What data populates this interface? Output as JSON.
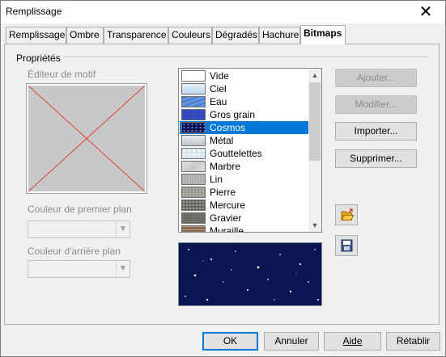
{
  "window": {
    "title": "Remplissage",
    "close_glyph": "✕"
  },
  "tabs": [
    {
      "label": "Remplissage"
    },
    {
      "label": "Ombre"
    },
    {
      "label": "Transparence"
    },
    {
      "label": "Couleurs"
    },
    {
      "label": "Dégradés"
    },
    {
      "label": "Hachure"
    },
    {
      "label": "Bitmaps",
      "active": true
    }
  ],
  "properties": {
    "section_label": "Propriétés",
    "pattern_editor_label": "Éditeur de motif",
    "foreground_color_label": "Couleur de premier plan",
    "foreground_color_value": "",
    "background_color_label": "Couleur d'arrière plan",
    "background_color_value": ""
  },
  "bitmaps": {
    "selected": "Cosmos",
    "items": [
      {
        "label": "Vide",
        "swatch": "#ffffff"
      },
      {
        "label": "Ciel",
        "swatch": "#cfe3f7"
      },
      {
        "label": "Eau",
        "swatch": "#4f7fd0"
      },
      {
        "label": "Gros grain",
        "swatch": "#1a2fa8"
      },
      {
        "label": "Cosmos",
        "swatch": "#0b1553"
      },
      {
        "label": "Métal",
        "swatch": "#d4d9de"
      },
      {
        "label": "Gouttelettes",
        "swatch": "#d6e4ef"
      },
      {
        "label": "Marbre",
        "swatch": "#d8d8d8"
      },
      {
        "label": "Lin",
        "swatch": "#a9a9a9"
      },
      {
        "label": "Pierre",
        "swatch": "#9a9a90"
      },
      {
        "label": "Mercure",
        "swatch": "#6b6b68"
      },
      {
        "label": "Gravier",
        "swatch": "#545450"
      },
      {
        "label": "Muraille",
        "swatch": "#8a6a52"
      }
    ]
  },
  "actions": {
    "add": "Ajouter...",
    "modify": "Modifier...",
    "import": "Importer...",
    "delete": "Supprimer..."
  },
  "footer": {
    "ok": "OK",
    "cancel": "Annuler",
    "help": "Aide",
    "reset": "Rétablir"
  },
  "colors": {
    "accent": "#0078d7",
    "preview_background": "#0b1553",
    "editor_cross": "#e0413a"
  },
  "icons": {
    "open_folder": "open-folder-icon",
    "save": "save-icon"
  }
}
